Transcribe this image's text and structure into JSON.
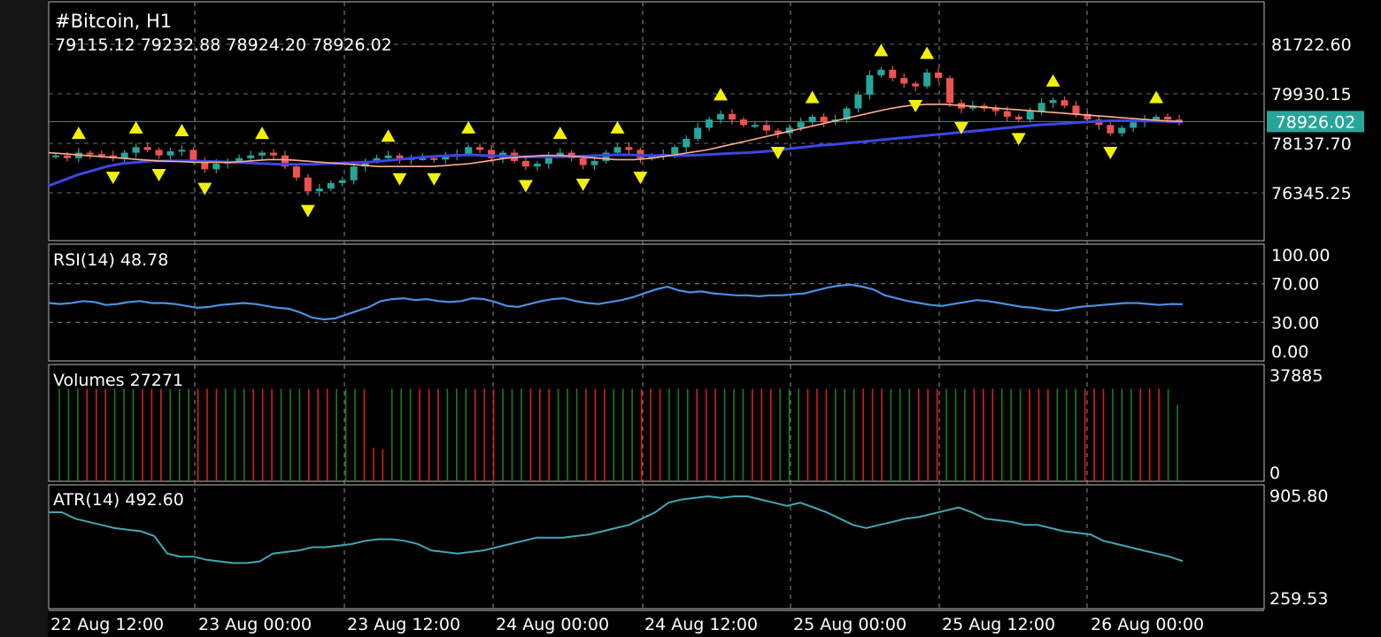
{
  "header": {
    "symbol": "#Bitcoin, H1",
    "ohlc": "79115.12 79232.88 78924.20 78926.02"
  },
  "price_axis": {
    "ticks": [
      "81722.60",
      "79930.15",
      "78137.70",
      "76345.25"
    ],
    "current": "78926.02",
    "current_color": "#26a69a"
  },
  "panes": {
    "rsi": {
      "label": "RSI(14) 48.78",
      "ticks": [
        "100.00",
        "70.00",
        "30.00",
        "0.00"
      ]
    },
    "volumes": {
      "label": "Volumes 27271",
      "ticks": [
        "37885",
        "0"
      ]
    },
    "atr": {
      "label": "ATR(14) 492.60",
      "ticks": [
        "905.80",
        "259.53"
      ]
    }
  },
  "time_axis": [
    "22 Aug 12:00",
    "23 Aug 00:00",
    "23 Aug 12:00",
    "24 Aug 00:00",
    "24 Aug 12:00",
    "25 Aug 00:00",
    "25 Aug 12:00",
    "26 Aug 00:00"
  ],
  "colors": {
    "bull": "#26a69a",
    "bear": "#ef5350",
    "ma_slow": "#3c46e6",
    "ma_fast": "#ffb08a",
    "rsi": "#4a90e2",
    "atr": "#40a6b6",
    "fractal": "#f2f200",
    "vol_up": "#1f7a1f",
    "vol_down": "#d42020"
  },
  "chart_data": [
    {
      "type": "candlestick",
      "title": "#Bitcoin, H1",
      "ylim": [
        75500,
        82300
      ],
      "x": [
        "22 Aug 12:00",
        "23 Aug 00:00",
        "23 Aug 12:00",
        "24 Aug 00:00",
        "24 Aug 12:00",
        "25 Aug 00:00",
        "25 Aug 12:00",
        "26 Aug 00:00"
      ],
      "close": [
        77700,
        77600,
        77800,
        77750,
        77700,
        77600,
        77800,
        78000,
        77900,
        77700,
        77850,
        77900,
        77500,
        77200,
        77400,
        77500,
        77600,
        77700,
        77800,
        77700,
        77300,
        76900,
        76400,
        76500,
        76700,
        76800,
        77300,
        77500,
        77600,
        77700,
        77550,
        77600,
        77600,
        77550,
        77700,
        77750,
        78000,
        77900,
        77600,
        77800,
        77500,
        77300,
        77400,
        77700,
        77800,
        77600,
        77350,
        77500,
        77800,
        78000,
        77900,
        77600,
        77650,
        77750,
        78000,
        78300,
        78700,
        79000,
        79200,
        79000,
        78800,
        78800,
        78600,
        78500,
        78700,
        78900,
        79100,
        78900,
        79000,
        79400,
        79900,
        80600,
        80800,
        80500,
        80300,
        80200,
        80700,
        80500,
        79600,
        79400,
        79500,
        79400,
        79300,
        79100,
        79000,
        79300,
        79600,
        79700,
        79500,
        79200,
        79000,
        78800,
        78500,
        78700,
        78900,
        79000,
        79100,
        79000,
        78926
      ],
      "series": [
        {
          "name": "MA",
          "role": "slow",
          "values": [
            76600,
            76800,
            77000,
            77150,
            77300,
            77400,
            77450,
            77500,
            77500,
            77500,
            77500,
            77480,
            77470,
            77450,
            77420,
            77400,
            77380,
            77380,
            77380,
            77400,
            77420,
            77440,
            77460,
            77500,
            77550,
            77600,
            77650,
            77680,
            77700,
            77720,
            77700,
            77680,
            77660,
            77650,
            77650,
            77650,
            77660,
            77680,
            77700,
            77720,
            77720,
            77700,
            77700,
            77700,
            77700,
            77720,
            77750,
            77780,
            77800,
            77830,
            77880,
            77950,
            78000,
            78060,
            78100,
            78150,
            78200,
            78250,
            78300,
            78350,
            78400,
            78450,
            78500,
            78550,
            78600,
            78650,
            78700,
            78750,
            78800,
            78830,
            78860,
            78900,
            78930,
            78950,
            78960,
            78950,
            78940,
            78930,
            78926
          ]
        },
        {
          "name": "MA",
          "role": "fast",
          "values": [
            77800,
            77750,
            77700,
            77650,
            77600,
            77550,
            77500,
            77480,
            77450,
            77450,
            77450,
            77500,
            77550,
            77550,
            77500,
            77450,
            77400,
            77350,
            77300,
            77300,
            77300,
            77300,
            77350,
            77400,
            77500,
            77600,
            77650,
            77700,
            77700,
            77650,
            77600,
            77550,
            77550,
            77600,
            77700,
            77800,
            77900,
            78050,
            78200,
            78350,
            78500,
            78650,
            78800,
            78950,
            79100,
            79250,
            79400,
            79500,
            79550,
            79550,
            79500,
            79450,
            79400,
            79350,
            79300,
            79250,
            79200,
            79150,
            79100,
            79050,
            79000,
            78950,
            78926
          ]
        }
      ]
    },
    {
      "type": "line",
      "title": "RSI(14) 48.78",
      "ylim": [
        0,
        100
      ],
      "levels": [
        70,
        30
      ],
      "values": [
        50,
        49,
        50,
        52,
        51,
        48,
        49,
        51,
        52,
        50,
        50,
        49,
        47,
        45,
        46,
        48,
        49,
        50,
        49,
        47,
        45,
        44,
        40,
        35,
        33,
        34,
        38,
        42,
        46,
        52,
        54,
        55,
        53,
        54,
        52,
        51,
        52,
        55,
        54,
        51,
        47,
        46,
        49,
        52,
        54,
        55,
        52,
        50,
        49,
        51,
        53,
        56,
        60,
        64,
        67,
        63,
        61,
        62,
        60,
        59,
        58,
        58,
        57,
        58,
        58,
        59,
        60,
        63,
        66,
        68,
        69,
        67,
        64,
        58,
        55,
        52,
        50,
        48,
        47,
        49,
        51,
        53,
        52,
        50,
        48,
        46,
        45,
        43,
        42,
        44,
        46,
        47,
        48,
        49,
        50,
        50,
        49,
        48,
        49,
        48.78
      ]
    },
    {
      "type": "bar",
      "title": "Volumes 27271",
      "ylim": [
        0,
        37885
      ],
      "values": [
        33000,
        33000,
        33000,
        33000,
        33000,
        33000,
        33000,
        33000,
        33000,
        33000,
        33000,
        33000,
        33000,
        33000,
        33000,
        33000,
        33000,
        33000,
        33000,
        33000,
        33000,
        33000,
        33000,
        33000,
        33000,
        33000,
        33000,
        33000,
        33000,
        33000,
        33000,
        33000,
        33000,
        33000,
        12000,
        11500,
        33000,
        33000,
        33000,
        33000,
        33000,
        33000,
        33000,
        33000,
        33000,
        33000,
        33000,
        33000,
        33000,
        33000,
        33000,
        33000,
        33000,
        33000,
        33000,
        33000,
        33000,
        33000,
        33000,
        33000,
        33000,
        33000,
        33000,
        33000,
        33000,
        33000,
        33000,
        33000,
        33000,
        33000,
        33000,
        33000,
        33000,
        33000,
        33000,
        33000,
        33000,
        33000,
        33000,
        33000,
        33000,
        33000,
        33000,
        33000,
        33000,
        33000,
        33000,
        33000,
        33000,
        33000,
        33000,
        33000,
        33000,
        33000,
        33000,
        33000,
        33000,
        33000,
        33000,
        33000,
        33000,
        33000,
        33000,
        33000,
        33000,
        33000,
        33000,
        33000,
        33000,
        33000,
        33000,
        33000,
        33000,
        33000,
        33000,
        33000,
        33000,
        33000,
        33000,
        33000,
        33000,
        27271
      ]
    },
    {
      "type": "line",
      "title": "ATR(14) 492.60",
      "ylim": [
        259.53,
        905.8
      ],
      "values": [
        800,
        800,
        760,
        740,
        720,
        700,
        690,
        680,
        650,
        540,
        520,
        520,
        500,
        490,
        480,
        480,
        490,
        540,
        550,
        560,
        580,
        580,
        590,
        600,
        620,
        630,
        630,
        620,
        600,
        560,
        550,
        540,
        550,
        560,
        580,
        600,
        620,
        640,
        640,
        640,
        650,
        660,
        680,
        700,
        720,
        760,
        800,
        860,
        880,
        890,
        900,
        890,
        900,
        900,
        880,
        860,
        840,
        860,
        830,
        800,
        760,
        720,
        700,
        720,
        740,
        760,
        770,
        790,
        810,
        830,
        800,
        760,
        750,
        740,
        720,
        720,
        700,
        680,
        670,
        660,
        620,
        600,
        580,
        560,
        540,
        520,
        492.6
      ]
    }
  ]
}
